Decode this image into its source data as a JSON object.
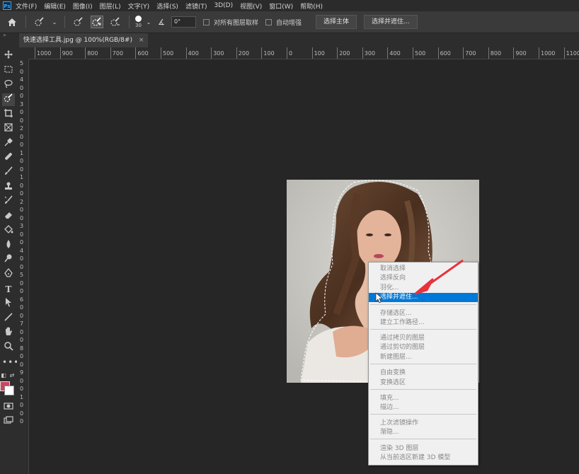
{
  "menubar": {
    "logo": "Ps",
    "items": [
      "文件(F)",
      "编辑(E)",
      "图像(I)",
      "图层(L)",
      "文字(Y)",
      "选择(S)",
      "滤镜(T)",
      "3D(D)",
      "视图(V)",
      "窗口(W)",
      "帮助(H)"
    ]
  },
  "options": {
    "brush_size": "30",
    "angle": "0°",
    "sample_all_layers": "对所有图层取样",
    "auto_enhance": "自动增强",
    "select_subject": "选择主体",
    "select_and_mask": "选择并遮住..."
  },
  "document": {
    "tab_title": "快速选择工具.jpg @ 100%(RGB/8#)",
    "close": "×"
  },
  "ruler": {
    "top_ticks": [
      "1000",
      "900",
      "800",
      "700",
      "600",
      "500",
      "400",
      "300",
      "200",
      "100",
      "0",
      "100",
      "200",
      "300",
      "400",
      "500",
      "600",
      "700",
      "800",
      "900",
      "1000",
      "1100"
    ],
    "left_ticks": [
      "5",
      "0",
      "4",
      "0",
      "0",
      "3",
      "0",
      "0",
      "2",
      "0",
      "0",
      "1",
      "0",
      "0",
      "1",
      "0",
      "0",
      "2",
      "0",
      "0",
      "3",
      "0",
      "0",
      "4",
      "0",
      "0",
      "5",
      "0",
      "0",
      "6",
      "0",
      "0",
      "7",
      "0",
      "0",
      "8",
      "0",
      "0",
      "9",
      "0",
      "0",
      "1",
      "0",
      "0",
      "0"
    ]
  },
  "colors": {
    "foreground": "#c8475e",
    "background": "#ffffff",
    "menu_highlight": "#0078d7",
    "arrow": "#e8323c"
  },
  "context_menu": {
    "items": [
      {
        "label": "取消选择",
        "state": "disabled"
      },
      {
        "label": "选择反向",
        "state": "disabled"
      },
      {
        "label": "羽化...",
        "state": "disabled"
      },
      {
        "label": "选择并遮住...",
        "state": "highlight"
      },
      {
        "label": "存储选区...",
        "state": "disabled"
      },
      {
        "label": "建立工作路径...",
        "state": "disabled"
      },
      {
        "label": "通过拷贝的图层",
        "state": "disabled"
      },
      {
        "label": "通过剪切的图层",
        "state": "disabled"
      },
      {
        "label": "新建图层...",
        "state": "disabled"
      },
      {
        "label": "自由变换",
        "state": "disabled"
      },
      {
        "label": "变换选区",
        "state": "disabled"
      },
      {
        "label": "填充...",
        "state": "disabled"
      },
      {
        "label": "描边...",
        "state": "disabled"
      },
      {
        "label": "上次滤镜操作",
        "state": "disabled"
      },
      {
        "label": "渐隐...",
        "state": "disabled"
      },
      {
        "label": "渲染 3D 图层",
        "state": "disabled"
      },
      {
        "label": "从当前选区新建 3D 模型",
        "state": "disabled"
      }
    ]
  },
  "tools": [
    "move-tool-icon",
    "marquee-tool-icon",
    "lasso-tool-icon",
    "quick-selection-tool-icon",
    "crop-tool-icon",
    "frame-tool-icon",
    "eyedropper-tool-icon",
    "healing-brush-icon",
    "brush-tool-icon",
    "clone-stamp-icon",
    "history-brush-icon",
    "eraser-tool-icon",
    "paint-bucket-icon",
    "blur-tool-icon",
    "dodge-tool-icon",
    "pen-tool-icon",
    "type-tool-icon",
    "path-selection-icon",
    "line-tool-icon",
    "hand-tool-icon",
    "zoom-tool-icon",
    "more-tools-icon"
  ]
}
